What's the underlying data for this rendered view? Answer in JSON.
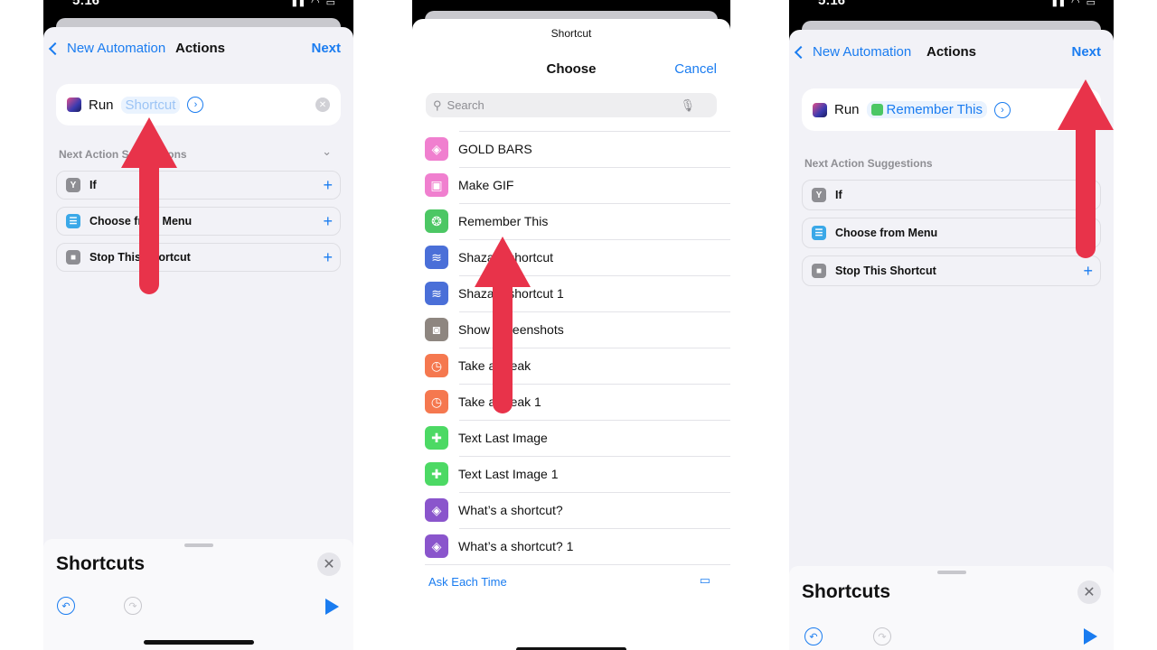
{
  "status_time": "5:16",
  "colors": {
    "accent": "#1a7cf0",
    "arrow": "#e8334a"
  },
  "left": {
    "nav": {
      "back": "New Automation",
      "title": "Actions",
      "next": "Next"
    },
    "run": {
      "label": "Run",
      "param": "Shortcut"
    },
    "suggestions_label": "Next Action Suggestions",
    "suggestions": [
      {
        "label": "If",
        "icon": "branch-icon",
        "color": "#8e8e93"
      },
      {
        "label": "Choose from Menu",
        "icon": "menu-icon",
        "color": "#3aa8e8"
      },
      {
        "label": "Stop This Shortcut",
        "icon": "stop-icon",
        "color": "#8e8e93"
      }
    ],
    "bottom": {
      "title": "Shortcuts"
    }
  },
  "middle": {
    "header": "Shortcut",
    "title": "Choose",
    "cancel": "Cancel",
    "search_placeholder": "Search",
    "items": [
      {
        "label": "GOLD BARS",
        "color": "#f07fcf",
        "icon": "layers-icon"
      },
      {
        "label": "Make GIF",
        "color": "#f07fcf",
        "icon": "photos-icon"
      },
      {
        "label": "Remember This",
        "color": "#4cc764",
        "icon": "brain-icon"
      },
      {
        "label": "Shazam shortcut",
        "color": "#4a6fd8",
        "icon": "waveform-icon"
      },
      {
        "label": "Shazam shortcut 1",
        "color": "#4a6fd8",
        "icon": "waveform-icon"
      },
      {
        "label": "Show Screenshots",
        "color": "#8e8680",
        "icon": "screenshot-icon"
      },
      {
        "label": "Take a break",
        "color": "#f5784f",
        "icon": "timer-icon"
      },
      {
        "label": "Take a break 1",
        "color": "#f5784f",
        "icon": "timer-icon"
      },
      {
        "label": "Text Last Image",
        "color": "#4cd964",
        "icon": "message-icon"
      },
      {
        "label": "Text Last Image 1",
        "color": "#4cd964",
        "icon": "message-icon"
      },
      {
        "label": "What’s a shortcut?",
        "color": "#8a55cc",
        "icon": "layers-icon"
      },
      {
        "label": "What’s a shortcut? 1",
        "color": "#8a55cc",
        "icon": "layers-icon"
      }
    ],
    "ask_each_time": "Ask Each Time"
  },
  "right": {
    "nav": {
      "back": "New Automation",
      "title": "Actions",
      "next": "Next"
    },
    "run": {
      "label": "Run",
      "param": "Remember This"
    },
    "suggestions_label": "Next Action Suggestions",
    "suggestions": [
      {
        "label": "If"
      },
      {
        "label": "Choose from Menu"
      },
      {
        "label": "Stop This Shortcut"
      }
    ],
    "bottom": {
      "title": "Shortcuts"
    }
  }
}
